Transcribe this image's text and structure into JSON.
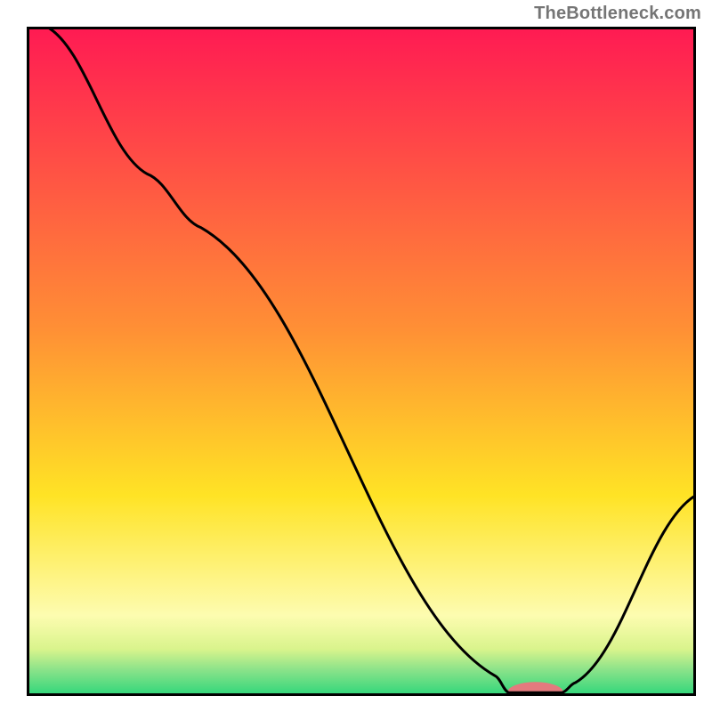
{
  "attribution": "TheBottleneck.com",
  "chart_data": {
    "type": "line",
    "title": "",
    "xlabel": "",
    "ylabel": "",
    "xlim": [
      0,
      100
    ],
    "ylim": [
      0,
      100
    ],
    "gradient_stops": [
      {
        "offset": 0,
        "color": "#ff1a53"
      },
      {
        "offset": 45,
        "color": "#ff8f35"
      },
      {
        "offset": 70,
        "color": "#ffe325"
      },
      {
        "offset": 88,
        "color": "#fdfcb0"
      },
      {
        "offset": 93,
        "color": "#d9f48c"
      },
      {
        "offset": 96,
        "color": "#8de38a"
      },
      {
        "offset": 100,
        "color": "#2dd67a"
      }
    ],
    "curve": [
      {
        "x": 3,
        "y": 100
      },
      {
        "x": 18,
        "y": 78
      },
      {
        "x": 26,
        "y": 70
      },
      {
        "x": 70,
        "y": 3
      },
      {
        "x": 72,
        "y": 0.5
      },
      {
        "x": 80,
        "y": 0.5
      },
      {
        "x": 82,
        "y": 2
      },
      {
        "x": 100,
        "y": 30
      }
    ],
    "marker": {
      "x": 76,
      "y": 0.5,
      "color": "#e47a7e",
      "rx": 4.2,
      "ry": 1.6
    },
    "frame_color": "#010101",
    "frame_width": 3,
    "line_color": "#000000",
    "line_width": 3
  }
}
